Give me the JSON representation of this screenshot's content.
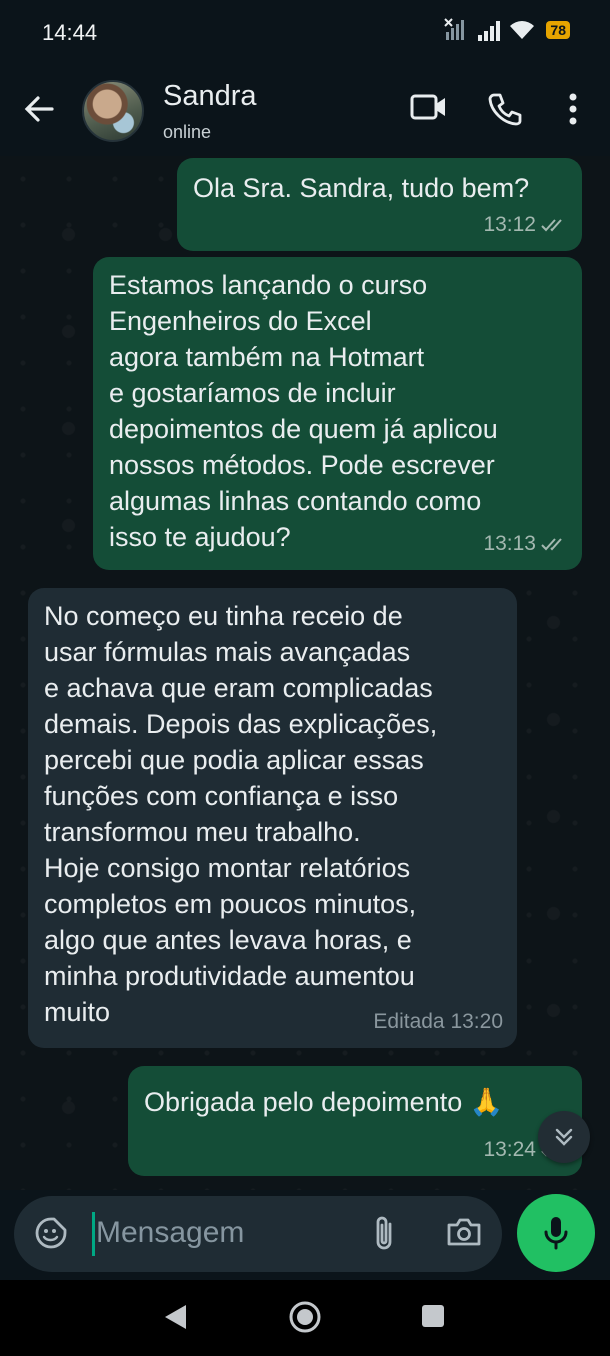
{
  "status_bar": {
    "time": "14:44",
    "battery": "78",
    "icons": [
      "no-signal-icon",
      "signal-icon",
      "wifi-icon",
      "battery-icon"
    ]
  },
  "header": {
    "contact_name": "Sandra",
    "status": "online",
    "icons": [
      "back-arrow-icon",
      "video-call-icon",
      "phone-icon",
      "more-vert-icon"
    ]
  },
  "messages": [
    {
      "direction": "outgoing",
      "text": "Ola Sra. Sandra, tudo bem?",
      "time": "13:12",
      "status": "read"
    },
    {
      "direction": "outgoing",
      "text": "Estamos lançando o curso\nEngenheiros do Excel\nagora também na Hotmart\ne gostaríamos de incluir\ndepoimentos de quem já aplicou\nnossos métodos. Pode escrever\nalgumas linhas contando como\nisso te ajudou?",
      "time": "13:13",
      "status": "read"
    },
    {
      "direction": "incoming",
      "text": "No começo eu tinha receio de\nusar fórmulas mais avançadas\ne achava que eram complicadas\ndemais. Depois das explicações,\npercebi que podia aplicar essas\nfunções com confiança e isso\ntransformou meu trabalho.\nHoje consigo montar relatórios\ncompletos em poucos minutos,\nalgo que antes levava horas, e\nminha produtividade aumentou\nmuito",
      "time": "Editada 13:20"
    },
    {
      "direction": "outgoing",
      "text": "Obrigada pelo depoimento 🙏",
      "time": "13:24",
      "status": "read"
    }
  ],
  "composer": {
    "placeholder": "Mensagem",
    "value": ""
  },
  "colors": {
    "outgoing_bubble": "#144d37",
    "incoming_bubble": "#1f2c34",
    "accent": "#21c063",
    "read_tick": "#a3b8b0"
  }
}
